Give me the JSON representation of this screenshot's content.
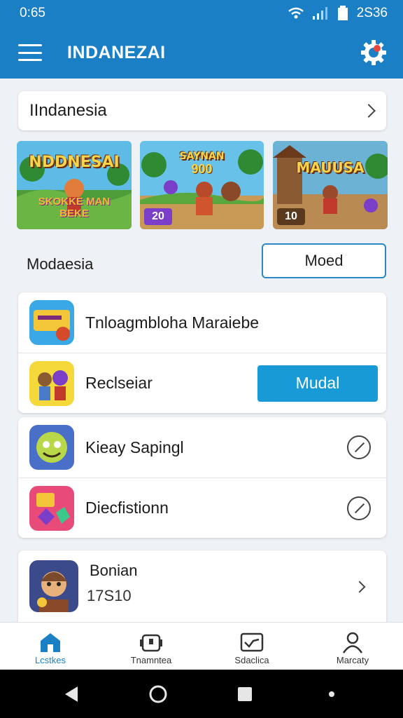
{
  "status_bar": {
    "time": "0:65",
    "battery": "2S36"
  },
  "app_bar": {
    "title": "INDANEZAI"
  },
  "top_card": {
    "label": "IIndanesia"
  },
  "banners": [
    {
      "title": "NDDNESAI",
      "subtitle": "",
      "badge": "",
      "footer": "SKOKKE MAN BEKE"
    },
    {
      "title": "SAYNAN",
      "subtitle": "900",
      "badge": "20",
      "footer": ""
    },
    {
      "title": "MAUUSA",
      "subtitle": "",
      "badge": "10",
      "footer": ""
    }
  ],
  "section": {
    "label": "Modaesia",
    "button": "Moed"
  },
  "list1": [
    {
      "label": "Tnloagmbloha Maraiebe",
      "icon": "game-icon"
    },
    {
      "label": "Reclseiar",
      "icon": "characters-icon",
      "action": "Mudal"
    }
  ],
  "list2": [
    {
      "label": "Kieay Sapingl",
      "icon": "face-icon"
    },
    {
      "label": "Diecfistionn",
      "icon": "gems-icon"
    }
  ],
  "last_item": {
    "title": "Bonian",
    "subtitle": "17S10"
  },
  "bottom_nav": [
    {
      "label": "Lcstkes",
      "icon": "home-icon"
    },
    {
      "label": "Tnamntea",
      "icon": "robot-icon"
    },
    {
      "label": "Sdaclica",
      "icon": "chart-icon"
    },
    {
      "label": "Marcaty",
      "icon": "person-icon"
    }
  ],
  "colors": {
    "primary": "#1b7fc6",
    "accent": "#189ad6",
    "background": "#eef1f5"
  }
}
